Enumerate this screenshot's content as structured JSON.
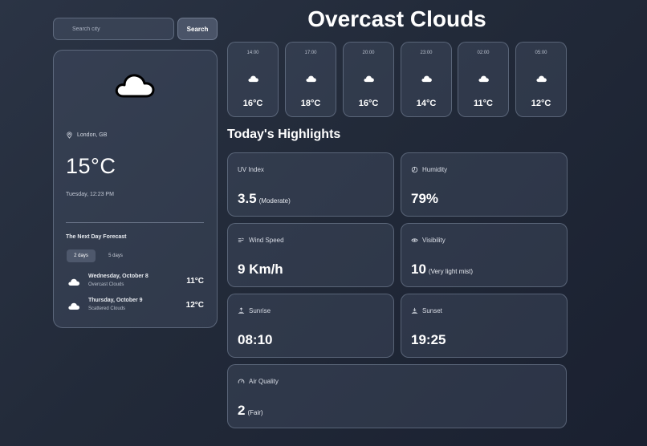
{
  "search": {
    "placeholder": "Search city",
    "button_label": "Search"
  },
  "current": {
    "icon": "cloud-icon",
    "location": "London, GB",
    "temperature": "15°C",
    "datetime": "Tuesday, 12:23 PM"
  },
  "forecast": {
    "title": "The Next Day Forecast",
    "tabs": [
      "2 days",
      "5 days"
    ],
    "active_tab": "2 days",
    "days": [
      {
        "day": "Wednesday, October 8",
        "desc": "Overcast Clouds",
        "temp": "11°C",
        "icon": "cloud-icon"
      },
      {
        "day": "Thursday, October 9",
        "desc": "Scattered Clouds",
        "temp": "12°C",
        "icon": "cloud-icon"
      }
    ]
  },
  "main": {
    "title": "Overcast Clouds",
    "highlights_title": "Today's Highlights"
  },
  "hourly": [
    {
      "time": "14:00",
      "temp": "16°C",
      "icon": "cloud-icon"
    },
    {
      "time": "17:00",
      "temp": "18°C",
      "icon": "cloud-icon"
    },
    {
      "time": "20:00",
      "temp": "16°C",
      "icon": "cloud-icon"
    },
    {
      "time": "23:00",
      "temp": "14°C",
      "icon": "cloud-icon"
    },
    {
      "time": "02:00",
      "temp": "11°C",
      "icon": "cloud-icon"
    },
    {
      "time": "05:00",
      "temp": "12°C",
      "icon": "cloud-icon"
    }
  ],
  "highlights": {
    "uv": {
      "label": "UV Index",
      "value": "3.5",
      "sub": "(Moderate)"
    },
    "humidity": {
      "label": "Humidity",
      "value": "79%",
      "sub": ""
    },
    "wind": {
      "label": "Wind Speed",
      "value": "9 Km/h",
      "sub": ""
    },
    "visibility": {
      "label": "Visibility",
      "value": "10",
      "sub": "(Very light mist)"
    },
    "sunrise": {
      "label": "Sunrise",
      "value": "08:10",
      "sub": ""
    },
    "sunset": {
      "label": "Sunset",
      "value": "19:25",
      "sub": ""
    },
    "air": {
      "label": "Air Quality",
      "value": "2",
      "sub": "(Fair)"
    }
  },
  "colors": {
    "background": "#222a39",
    "card": "#3a4456",
    "accent": "#4e586c"
  }
}
